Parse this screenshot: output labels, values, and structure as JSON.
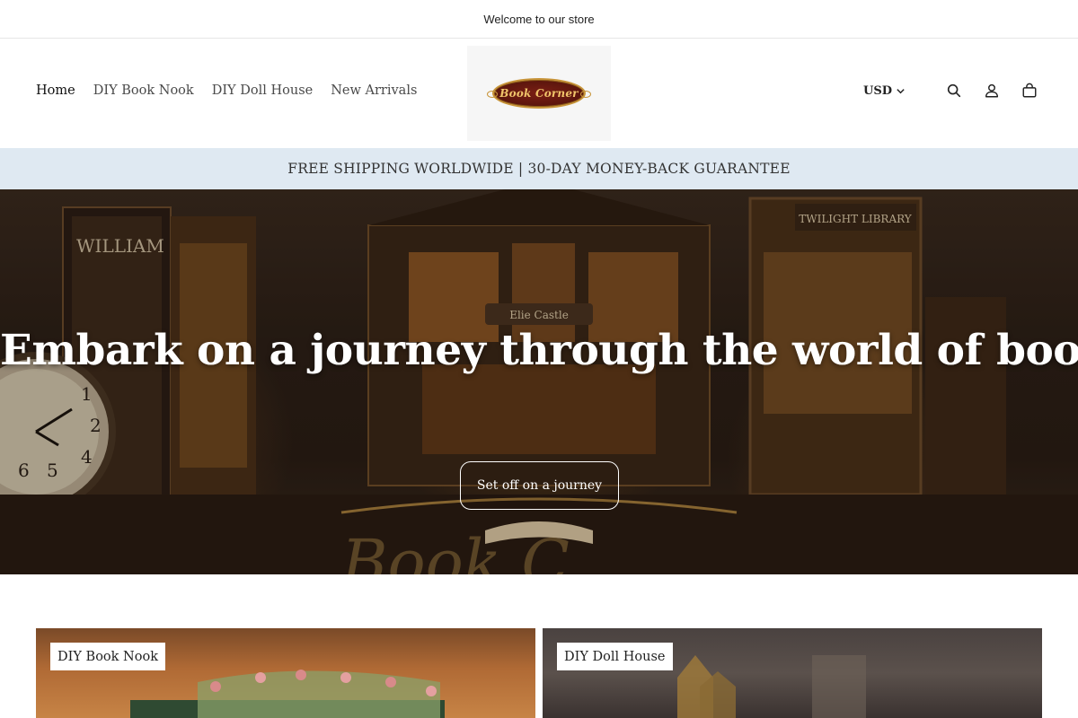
{
  "announcement": "Welcome to our store",
  "nav": {
    "items": [
      "Home",
      "DIY Book Nook",
      "DIY Doll House",
      "New Arrivals"
    ]
  },
  "logo": {
    "text": "Book Corner"
  },
  "header": {
    "currency": "USD",
    "icons": [
      "search-icon",
      "account-icon",
      "cart-icon"
    ]
  },
  "shipping_bar": "FREE SHIPPING WORLDWIDE | 30-DAY MONEY-BACK GUARANTEE",
  "hero": {
    "title": "Embark on a journey through the world of books",
    "button": "Set off on a journey",
    "image_signs": [
      "WILLIAM CASTLE",
      "Elie Castle",
      "TWILIGHT LIBRARY"
    ]
  },
  "collections": [
    {
      "label": "DIY Book Nook"
    },
    {
      "label": "DIY Doll House"
    }
  ],
  "colors": {
    "shipping_bar_bg": "#dfe9f2",
    "logo_red": "#5a150d",
    "logo_gold": "#c8953a"
  }
}
